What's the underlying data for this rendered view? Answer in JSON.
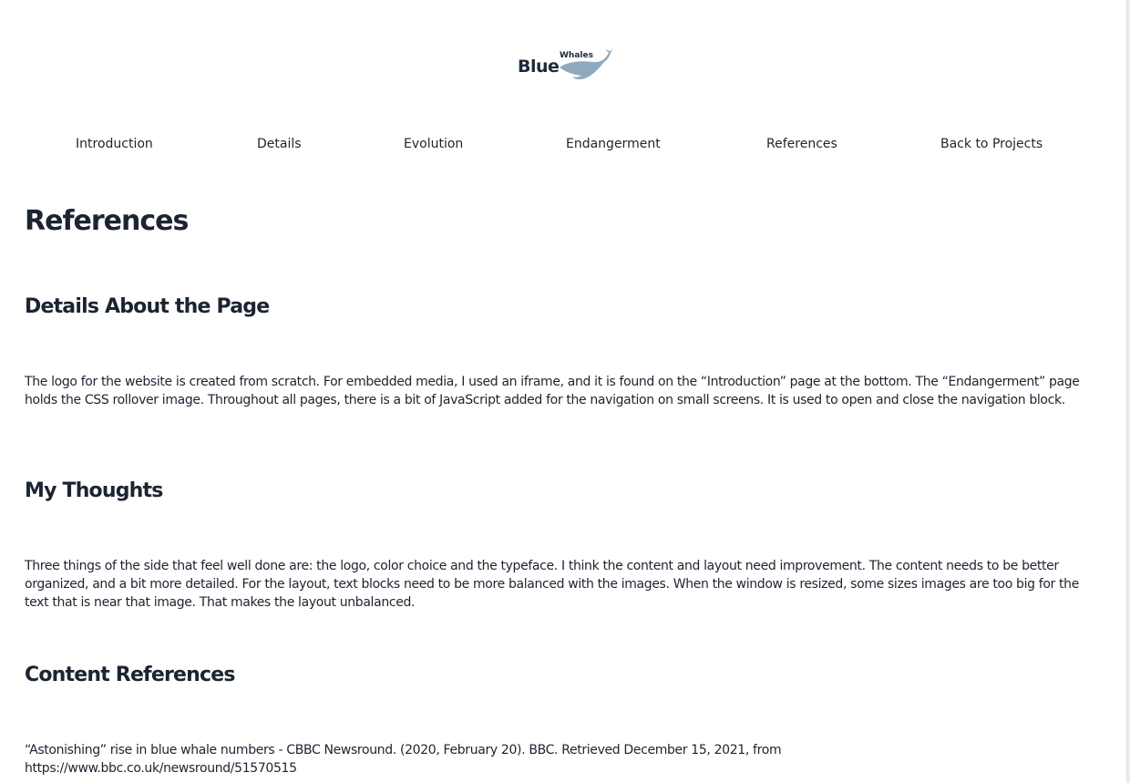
{
  "logo": {
    "word_blue": "Blue",
    "word_whales": "Whales",
    "whale_color": "#8fa9bf"
  },
  "nav": {
    "items": [
      {
        "label": "Introduction"
      },
      {
        "label": "Details"
      },
      {
        "label": "Evolution"
      },
      {
        "label": "Endangerment"
      },
      {
        "label": "References"
      },
      {
        "label": "Back to Projects"
      }
    ]
  },
  "page": {
    "title": "References"
  },
  "sections": [
    {
      "heading": "Details About the Page",
      "body": "The logo for the website is created from scratch. For embedded media, I used an iframe, and it is found on the “Introduction” page at the bottom. The “Endangerment” page holds the CSS rollover image. Throughout all pages, there is a bit of JavaScript added for the navigation on small screens. It is used to open and close the navigation block."
    },
    {
      "heading": "My Thoughts",
      "body": "Three things of the side that feel well done are: the logo, color choice and the typeface. I think the content and layout need improvement. The content needs to be better organized, and a bit more detailed. For the layout, text blocks need to be more balanced with the images. When the window is resized, some sizes images are too big for the text that is near that image. That makes the layout unbalanced."
    },
    {
      "heading": "Content References",
      "body": "“Astonishing” rise in blue whale numbers - CBBC Newsround. (2020, February 20). BBC. Retrieved December 15, 2021, from https://www.bbc.co.uk/newsround/51570515"
    }
  ]
}
